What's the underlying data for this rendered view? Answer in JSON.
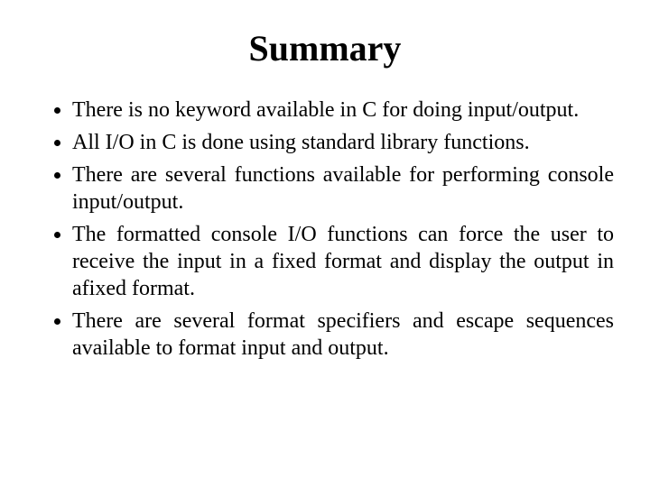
{
  "title": "Summary",
  "bullets": [
    "There is no keyword available in C for doing input/output.",
    "All I/O in C is done using standard library functions.",
    "There are several functions available for performing console input/output.",
    "The formatted console I/O functions can force the user to receive the input in a fixed format and display the output in afixed format.",
    "There are several format specifiers and escape sequences available to format input and output."
  ]
}
